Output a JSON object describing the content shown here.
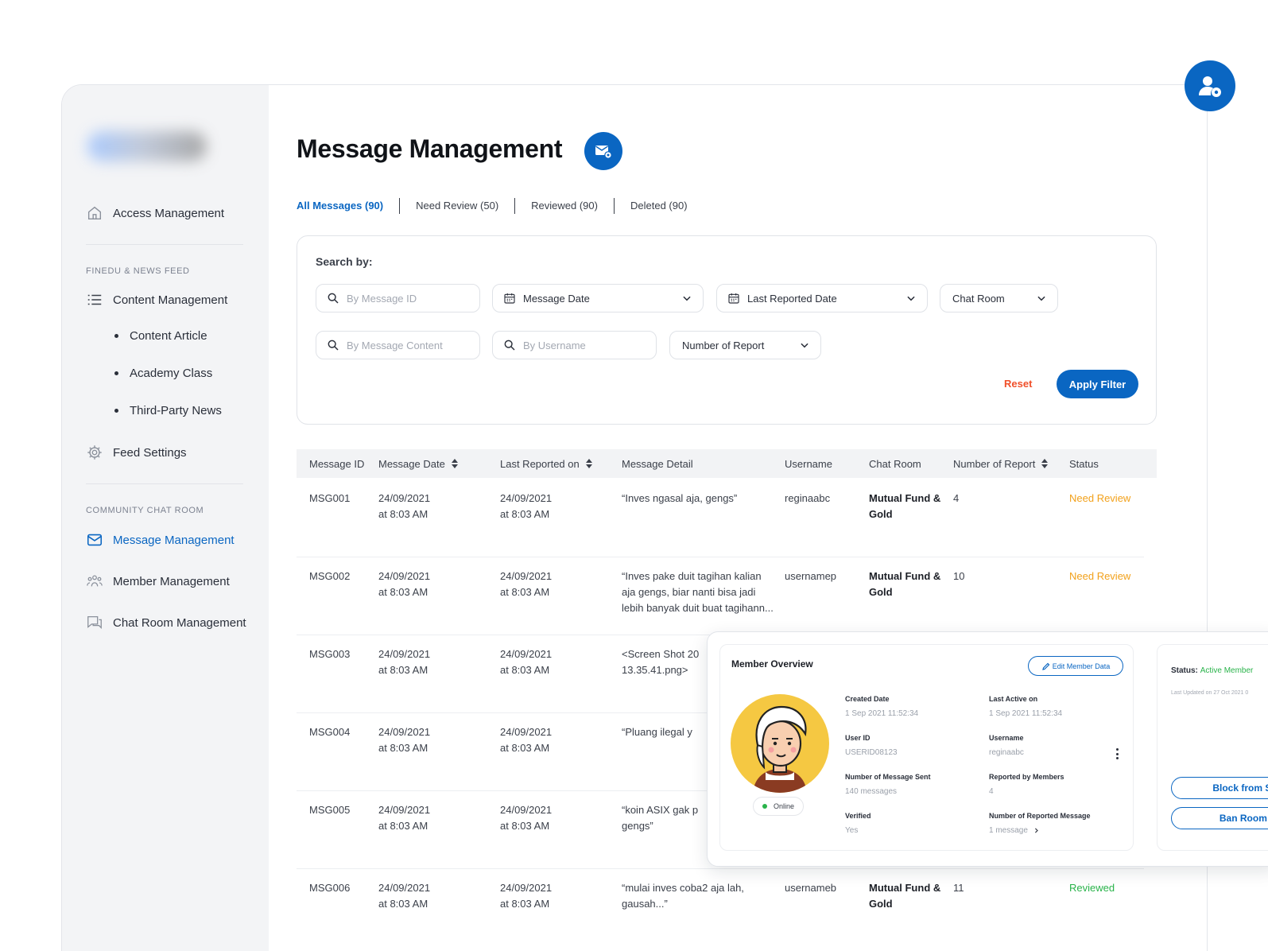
{
  "sidebar": {
    "access": "Access Management",
    "section1": "FINEDU & NEWS FEED",
    "content_management": "Content Management",
    "sub_items": [
      "Content Article",
      "Academy Class",
      "Third-Party News"
    ],
    "feed_settings": "Feed Settings",
    "section2": "COMMUNITY CHAT ROOM",
    "message_management": "Message Management",
    "member_management": "Member Management",
    "chat_room_management": "Chat Room Management"
  },
  "page": {
    "title": "Message Management"
  },
  "tabs": [
    "All Messages (90)",
    "Need Review (50)",
    "Reviewed (90)",
    "Deleted (90)"
  ],
  "filters": {
    "search_label": "Search by:",
    "message_id_placeholder": "By Message ID",
    "message_date": "Message Date",
    "last_reported_date": "Last Reported Date",
    "chat_room": "Chat Room",
    "message_content_placeholder": "By Message Content",
    "username_placeholder": "By Username",
    "number_of_report": "Number of Report",
    "reset": "Reset",
    "apply": "Apply Filter"
  },
  "table": {
    "headers": [
      "Message ID",
      "Message Date",
      "Last Reported on",
      "Message Detail",
      "Username",
      "Chat Room",
      "Number of Report",
      "Status"
    ],
    "rows": [
      {
        "id": "MSG001",
        "date1": "24/09/2021",
        "time1": "at 8:03 AM",
        "date2": "24/09/2021",
        "time2": "at 8:03 AM",
        "detail1": "“Inves ngasal aja, gengs”",
        "detail2": "",
        "detail3": "",
        "username": "reginaabc",
        "room1": "Mutual Fund &",
        "room2": "Gold",
        "reports": "4",
        "status": "Need Review"
      },
      {
        "id": "MSG002",
        "date1": "24/09/2021",
        "time1": "at 8:03 AM",
        "date2": "24/09/2021",
        "time2": "at 8:03 AM",
        "detail1": "“Inves pake duit tagihan kalian",
        "detail2": "aja gengs, biar nanti bisa jadi",
        "detail3": "lebih banyak duit buat tagihann...",
        "username": "usernamep",
        "room1": "Mutual Fund &",
        "room2": "Gold",
        "reports": "10",
        "status": "Need Review"
      },
      {
        "id": "MSG003",
        "date1": "24/09/2021",
        "time1": "at 8:03 AM",
        "date2": "24/09/2021",
        "time2": "at 8:03 AM",
        "detail1": "<Screen Shot 20",
        "detail2": "13.35.41.png>",
        "detail3": "",
        "username": "",
        "room1": "",
        "room2": "",
        "reports": "",
        "status": ""
      },
      {
        "id": "MSG004",
        "date1": "24/09/2021",
        "time1": "at 8:03 AM",
        "date2": "24/09/2021",
        "time2": "at 8:03 AM",
        "detail1": "“Pluang ilegal y",
        "detail2": "",
        "detail3": "",
        "username": "",
        "room1": "",
        "room2": "",
        "reports": "",
        "status": ""
      },
      {
        "id": "MSG005",
        "date1": "24/09/2021",
        "time1": "at 8:03 AM",
        "date2": "24/09/2021",
        "time2": "at 8:03 AM",
        "detail1": "“koin ASIX gak p",
        "detail2": "gengs”",
        "detail3": "",
        "username": "",
        "room1": "",
        "room2": "",
        "reports": "",
        "status": ""
      },
      {
        "id": "MSG006",
        "date1": "24/09/2021",
        "time1": "at 8:03 AM",
        "date2": "24/09/2021",
        "time2": "at 8:03 AM",
        "detail1": "“mulai inves coba2 aja lah,",
        "detail2": "gausah...”",
        "detail3": "",
        "username": "usernameb",
        "room1": "Mutual Fund &",
        "room2": "Gold",
        "reports": "11",
        "status": "Reviewed"
      }
    ]
  },
  "member_overview": {
    "title": "Member Overview",
    "edit_button": "Edit Member Data",
    "online": "Online",
    "created_label": "Created Date",
    "created_value": "1 Sep 2021 11:52:34",
    "last_active_label": "Last Active on",
    "last_active_value": "1 Sep 2021 11:52:34",
    "user_id_label": "User ID",
    "user_id_value": "USERID08123",
    "username_label": "Username",
    "username_value": "reginaabc",
    "sent_label": "Number of Message Sent",
    "sent_value": "140 messages",
    "reported_by_label": "Reported by Members",
    "reported_by_value": "4",
    "verified_label": "Verified",
    "verified_value": "Yes",
    "reported_msg_label": "Number of Reported Message",
    "reported_msg_value": "1 message"
  },
  "member_status": {
    "label": "Status:",
    "value": "Active Member",
    "updated": "Last Updated on 27 Oct 2021 0",
    "block_button": "Block from Send",
    "ban_button": "Ban Room Ac"
  },
  "colors": {
    "primary": "#0a66c2",
    "need_review": "#f2a11b",
    "reviewed": "#29b34a",
    "reset": "#f0502a"
  }
}
